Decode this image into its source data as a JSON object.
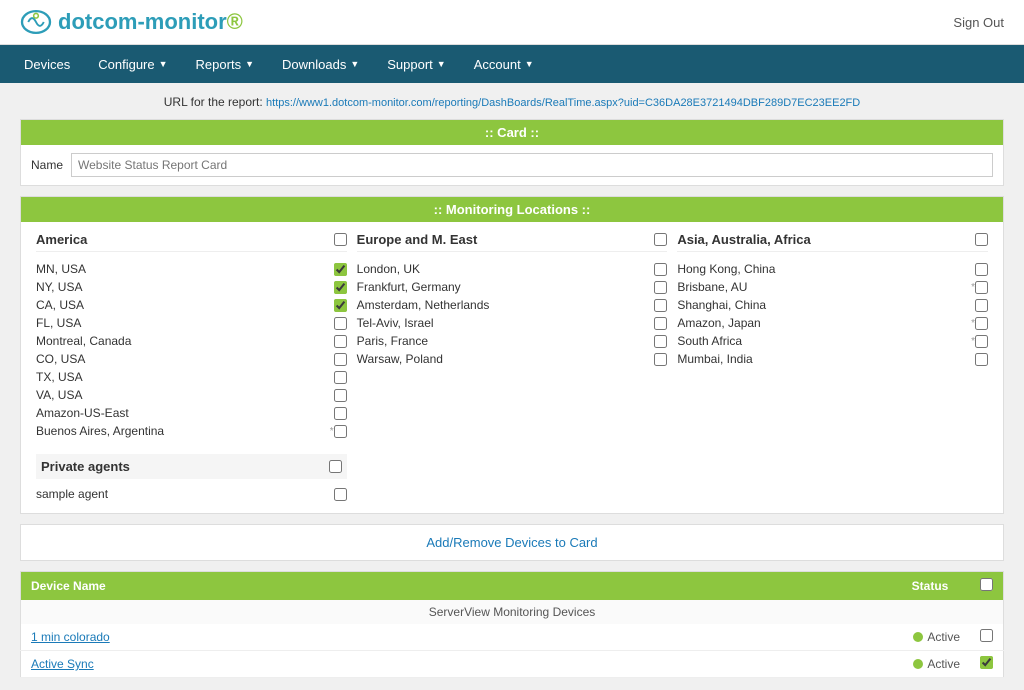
{
  "topbar": {
    "logo_alt": "dotcom-monitor",
    "sign_out_label": "Sign Out"
  },
  "nav": {
    "items": [
      {
        "label": "Devices",
        "has_dropdown": false
      },
      {
        "label": "Configure",
        "has_dropdown": true
      },
      {
        "label": "Reports",
        "has_dropdown": true
      },
      {
        "label": "Downloads",
        "has_dropdown": true
      },
      {
        "label": "Support",
        "has_dropdown": true
      },
      {
        "label": "Account",
        "has_dropdown": true
      }
    ]
  },
  "report_url": {
    "prefix": "URL for the report:",
    "url": "https://www1.dotcom-monitor.com/reporting/DashBoards/RealTime.aspx?uid=C36DA28E3721494DBF289D7EC23EE2FD"
  },
  "card_section": {
    "header": ":: Card ::",
    "name_label": "Name",
    "name_placeholder": "Website Status Report Card"
  },
  "monitoring_section": {
    "header": ":: Monitoring Locations ::",
    "america": {
      "title": "America",
      "locations": [
        {
          "name": "MN, USA",
          "checked": true
        },
        {
          "name": "NY, USA",
          "checked": true
        },
        {
          "name": "CA, USA",
          "checked": true
        },
        {
          "name": "FL, USA",
          "checked": false
        },
        {
          "name": "Montreal, Canada",
          "checked": false
        },
        {
          "name": "CO, USA",
          "checked": false
        },
        {
          "name": "TX, USA",
          "checked": false
        },
        {
          "name": "VA, USA",
          "checked": false
        },
        {
          "name": "Amazon-US-East",
          "checked": false
        },
        {
          "name": "Buenos Aires, Argentina",
          "checked": false,
          "asterisk": true
        }
      ]
    },
    "europe": {
      "title": "Europe and M. East",
      "locations": [
        {
          "name": "London, UK",
          "checked": false
        },
        {
          "name": "Frankfurt, Germany",
          "checked": false
        },
        {
          "name": "Amsterdam, Netherlands",
          "checked": false
        },
        {
          "name": "Tel-Aviv, Israel",
          "checked": false
        },
        {
          "name": "Paris, France",
          "checked": false
        },
        {
          "name": "Warsaw, Poland",
          "checked": false
        }
      ]
    },
    "asia": {
      "title": "Asia, Australia, Africa",
      "locations": [
        {
          "name": "Hong Kong, China",
          "checked": false
        },
        {
          "name": "Brisbane, AU",
          "checked": false,
          "asterisk": true
        },
        {
          "name": "Shanghai, China",
          "checked": false
        },
        {
          "name": "Amazon, Japan",
          "checked": false,
          "asterisk": true
        },
        {
          "name": "South Africa",
          "checked": false,
          "asterisk": true
        },
        {
          "name": "Mumbai, India",
          "checked": false
        }
      ]
    }
  },
  "private_agents": {
    "title": "Private agents",
    "agents": [
      {
        "name": "sample agent",
        "checked": false
      }
    ]
  },
  "add_remove": {
    "label": "Add/Remove Devices to Card"
  },
  "devices_table": {
    "headers": [
      "Device Name",
      "Status",
      ""
    ],
    "groups": [
      {
        "group_name": "ServerView Monitoring Devices",
        "devices": [
          {
            "name": "1 min colorado",
            "status": "Active",
            "checked": false
          },
          {
            "name": "Active Sync",
            "status": "Active",
            "checked": true
          }
        ]
      }
    ]
  }
}
